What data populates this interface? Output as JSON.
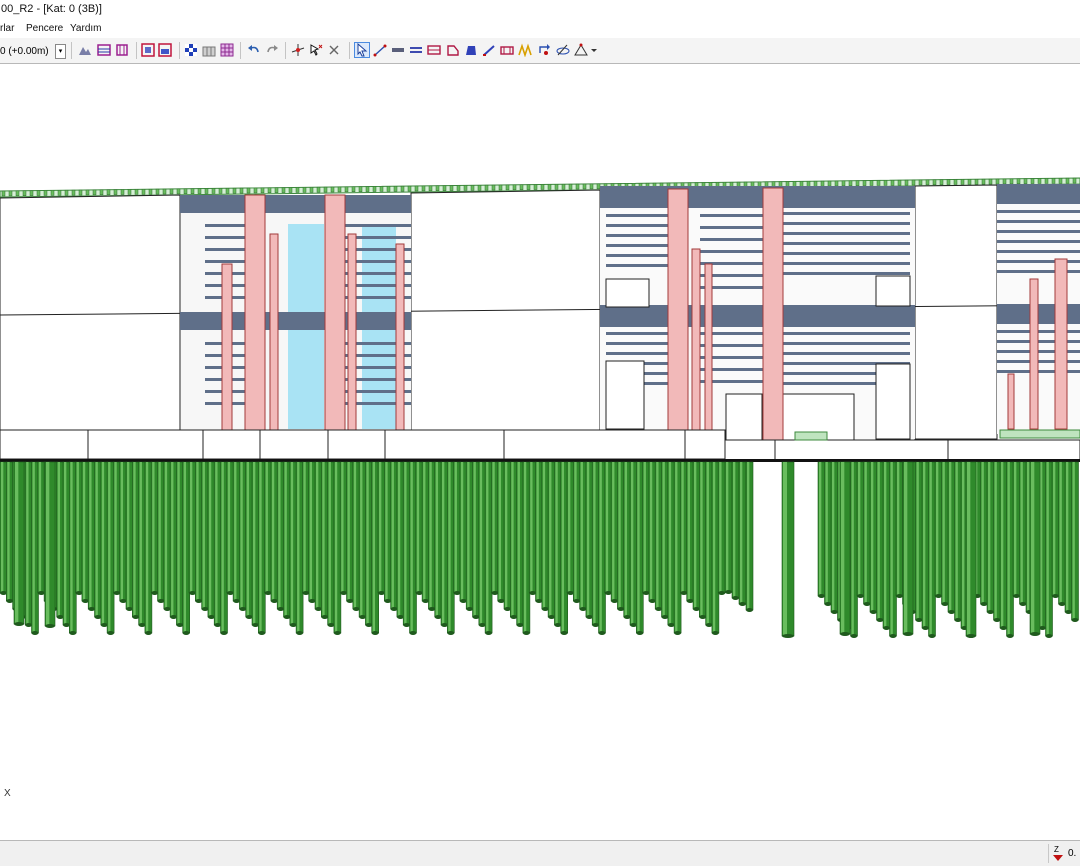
{
  "window": {
    "title": "00_R2 - [Kat: 0 (3B)]"
  },
  "menu": {
    "items": [
      "rlar",
      "Pencere",
      "Yardım"
    ]
  },
  "toolbar": {
    "level_value": "0 (+0.00m)",
    "tools": [
      "elevation-view",
      "column-grid",
      "section-marker",
      "window-frame",
      "floor-fill",
      "checker-pattern",
      "building-block",
      "table-grid",
      "undo",
      "redo",
      "move-object",
      "select-move",
      "delete",
      "select-pointer",
      "draw-line",
      "beam",
      "double-beam",
      "wall-beam",
      "slab",
      "shape-fill",
      "diagonal-brace",
      "dimension",
      "truss",
      "rotate-view",
      "orbit-view"
    ],
    "active_tool": "select-pointer"
  },
  "viewport": {
    "axis_label": "X"
  },
  "statusbar": {
    "zoom_value": "0."
  },
  "colors": {
    "column": "#f2b9b9",
    "column_edge": "#a23a3a",
    "beam": "#5f6f89",
    "glass": "#a9e3f4",
    "pile": "#2f8a2b",
    "pile_light": "#69bd5e",
    "foundation": "#ffffff",
    "parapet": "#7ac67a"
  }
}
